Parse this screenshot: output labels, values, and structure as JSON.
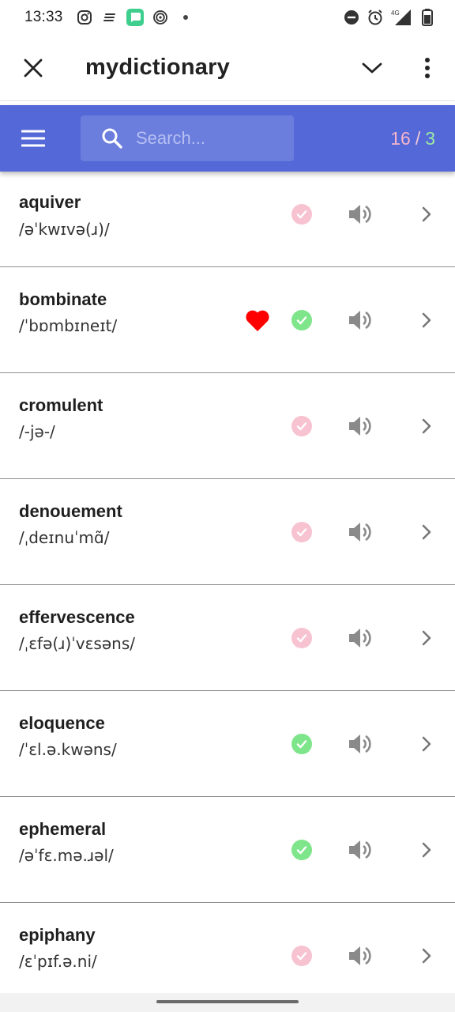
{
  "status_bar": {
    "time": "13:33",
    "left_icons": [
      "instagram-icon",
      "notes-icon",
      "messaging-app-icon",
      "spiral-app-icon",
      "dot-icon"
    ],
    "right_icons": [
      "do-not-disturb-icon",
      "alarm-icon",
      "signal-4g-icon",
      "battery-icon"
    ],
    "network_label": "4G"
  },
  "app_bar": {
    "title": "mydictionary"
  },
  "toolbar": {
    "search_placeholder": "Search...",
    "total_count": "16",
    "separator": "/",
    "learned_count": "3",
    "colors": {
      "background": "#5468d7",
      "total": "#f6b5cc",
      "learned": "#9ee8a6"
    }
  },
  "words": [
    {
      "word": "aquiver",
      "phonetic": "/əˈkwɪvə(ɹ)/",
      "favorite": false,
      "learned": false
    },
    {
      "word": "bombinate",
      "phonetic": "/ˈbɒmbɪneɪt/",
      "favorite": true,
      "learned": true
    },
    {
      "word": "cromulent",
      "phonetic": "/-jə-/",
      "favorite": false,
      "learned": false
    },
    {
      "word": "denouement",
      "phonetic": "/ˌdeɪnuˈmɑ̃/",
      "favorite": false,
      "learned": false
    },
    {
      "word": "effervescence",
      "phonetic": "/ˌɛfə(ɹ)ˈvɛsəns/",
      "favorite": false,
      "learned": false
    },
    {
      "word": "eloquence",
      "phonetic": "/ˈɛl.ə.kwəns/",
      "favorite": false,
      "learned": true
    },
    {
      "word": "ephemeral",
      "phonetic": "/əˈfɛ.mə.ɹəl/",
      "favorite": false,
      "learned": true
    },
    {
      "word": "epiphany",
      "phonetic": "/ɛˈpɪf.ə.ni/",
      "favorite": false,
      "learned": false
    }
  ],
  "colors": {
    "learned_check": "#7ee58b",
    "unlearned_check": "#f7c3d0",
    "favorite_heart": "#ff0000",
    "speaker": "#8a8a8a"
  }
}
